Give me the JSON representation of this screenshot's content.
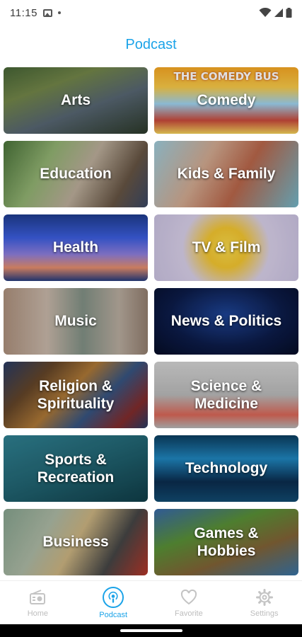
{
  "status": {
    "time": "11:15"
  },
  "header": {
    "title": "Podcast"
  },
  "categories": [
    {
      "label": "Arts"
    },
    {
      "label": "Comedy"
    },
    {
      "label": "Education"
    },
    {
      "label": "Kids & Family"
    },
    {
      "label": "Health"
    },
    {
      "label": "TV & Film"
    },
    {
      "label": "Music"
    },
    {
      "label": "News & Politics"
    },
    {
      "label": "Religion &\nSpirituality"
    },
    {
      "label": "Science &\nMedicine"
    },
    {
      "label": "Sports &\nRecreation"
    },
    {
      "label": "Technology"
    },
    {
      "label": "Business"
    },
    {
      "label": "Games &\nHobbies"
    }
  ],
  "tile_image_text": {
    "comedy_banner": "THE COMEDY BUS"
  },
  "nav": {
    "items": [
      {
        "label": "Home",
        "icon": "radio-icon"
      },
      {
        "label": "Podcast",
        "icon": "podcast-icon"
      },
      {
        "label": "Favorite",
        "icon": "heart-icon"
      },
      {
        "label": "Settings",
        "icon": "gear-icon"
      }
    ],
    "active": "Podcast"
  },
  "colors": {
    "accent": "#1ba3e8",
    "inactive": "#bdbdbd"
  }
}
